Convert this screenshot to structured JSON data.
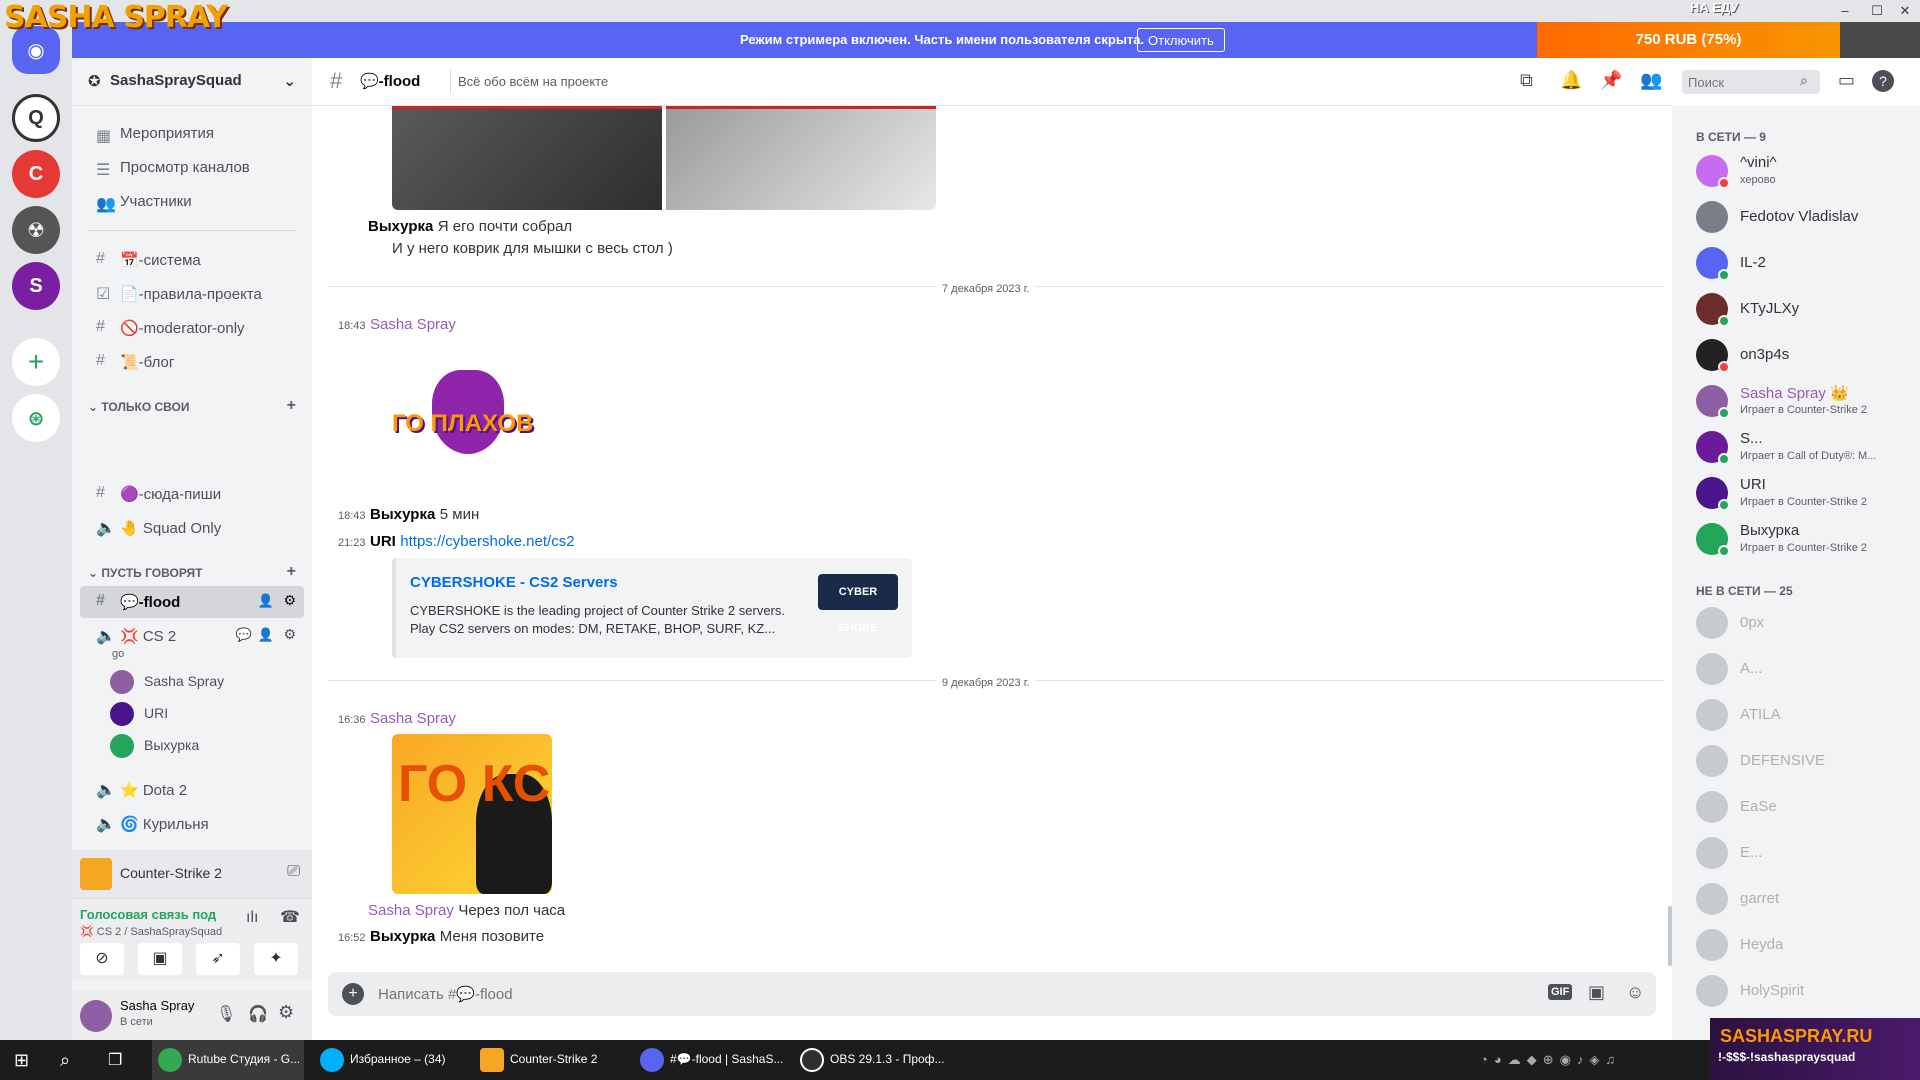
{
  "overlay": {
    "logo": "SASHA SPRAY",
    "donate_label": "НА ЕДУ",
    "donate_amount": "750 RUB (75%)",
    "brand_bottom": "SASHASPRAY.RU",
    "brand_sub": "!-$$$-!sashaspraysquad"
  },
  "banner": {
    "text": "Режим стримера включен. Часть имени пользователя скрыта.",
    "button": "Отключить"
  },
  "window": {
    "minimize": "–",
    "maximize": "☐",
    "close": "✕"
  },
  "guild": {
    "name": "SashaSpraySquad"
  },
  "sidebar": {
    "top_items": [
      {
        "label": "Мероприятия",
        "icon": "calendar-icon"
      },
      {
        "label": "Просмотр каналов",
        "icon": "channels-browse-icon"
      },
      {
        "label": "Участники",
        "icon": "members-icon"
      }
    ],
    "channels": [
      {
        "label": "📅-система",
        "icon": "hash-icon"
      },
      {
        "label": "📄-правила-проекта",
        "icon": "rules-icon"
      },
      {
        "label": "🚫-moderator-only",
        "icon": "hash-icon"
      },
      {
        "label": "📜-блог",
        "icon": "hash-icon"
      }
    ],
    "category_1": "ТОЛЬКО СВОИ",
    "cat1_channels": [
      {
        "label": "🟣-сюда-пиши",
        "icon": "hash-icon"
      },
      {
        "label": "🤚 Squad Only",
        "icon": "speaker-icon"
      }
    ],
    "category_2": "ПУСТЬ ГОВОРЯТ",
    "active_channel": "💬-flood",
    "voice_cs2": "💢 CS 2",
    "voice_cs2_status": "go",
    "voice_users": [
      "Sasha Spray",
      "URI",
      "Выхурка"
    ],
    "voice_dota": "⭐ Dota 2",
    "voice_smoke": "🌀 Курильня"
  },
  "activity": {
    "game": "Counter-Strike 2"
  },
  "voice_panel": {
    "status": "Голосовая связь под",
    "channel": "💢 CS 2 / SashaSpraySquad"
  },
  "user": {
    "name": "Sasha Spray",
    "status": "В сети"
  },
  "chat_header": {
    "channel": "💬-flood",
    "topic": "Всё обо всём на проекте",
    "search_placeholder": "Поиск"
  },
  "messages": {
    "m1_author": "Выхурка",
    "m1_text": "Я его почти собрал",
    "m1_text2": "И у него коврик для мышки с весь стол )",
    "date1": "7 декабря 2023 г.",
    "m2_time": "18:43",
    "m2_author": "Sasha Spray",
    "m2_sticker": "ГО ПЛАХОВ",
    "m3_time": "18:43",
    "m3_author": "Выхурка",
    "m3_text": "5 мин",
    "m4_time": "21:23",
    "m4_author": "URI",
    "m4_link": "https://cybershoke.net/cs2",
    "embed_title": "CYBERSHOKE - CS2 Servers",
    "embed_desc": "CYBERSHOKE is the leading project of Counter Strike 2 servers. Play CS2 servers on modes: DM, RETAKE, BHOP, SURF, KZ...",
    "embed_logo": "CYBER SHOKE",
    "date2": "9 декабря 2023 г.",
    "m5_time": "16:36",
    "m5_author": "Sasha Spray",
    "m5_image_text": "ГО КС",
    "m6_author": "Sasha Spray",
    "m6_text": "Через пол часа",
    "m7_time": "16:52",
    "m7_author": "Выхурка",
    "m7_text": "Меня позовите"
  },
  "input": {
    "placeholder": "Написать #💬-flood",
    "gif": "GIF"
  },
  "members": {
    "online_header": "В СЕТИ — 9",
    "online": [
      {
        "name": "^vini^",
        "sub": "херово",
        "color": "#c56cf0",
        "status": "#f23f43"
      },
      {
        "name": "Fedotov Vladislav",
        "sub": "",
        "color": "#7a7f87",
        "status": ""
      },
      {
        "name": "IL-2",
        "sub": "",
        "color": "#5865f2",
        "status": "#23a55a"
      },
      {
        "name": "KTyJLXy",
        "sub": "",
        "color": "#6b2d2d",
        "status": "#23a55a"
      },
      {
        "name": "on3p4s",
        "sub": "",
        "color": "#222222",
        "status": "#f23f43"
      },
      {
        "name": "Sasha Spray 👑",
        "sub": "Играет в Counter-Strike 2",
        "color": "#8e5ea2",
        "status": "#23a55a"
      },
      {
        "name": "S...",
        "sub": "Играет в Call of Duty®: M...",
        "color": "#6a1b9a",
        "status": "#23a55a"
      },
      {
        "name": "URI",
        "sub": "Играет в Counter-Strike 2",
        "color": "#4a148c",
        "status": "#23a55a"
      },
      {
        "name": "Выхурка",
        "sub": "Играет в Counter-Strike 2",
        "color": "#23a55a",
        "status": "#23a55a"
      }
    ],
    "offline_header": "НЕ В СЕТИ — 25",
    "offline": [
      "0px",
      "A...",
      "ATILA",
      "DEFENSIVE",
      "EaSe",
      "E...",
      "garret",
      "Heyda",
      "HolySpirit"
    ]
  },
  "taskbar": {
    "apps": [
      "Rutube Студия - G...",
      "Избранное – (34)",
      "Counter-Strike 2",
      "#💬-flood | SashaS...",
      "OBS 29.1.3 - Проф..."
    ]
  },
  "colors": {
    "accent": "#5865f2",
    "online": "#23a55a",
    "dnd": "#f23f43",
    "link": "#006ce7"
  }
}
